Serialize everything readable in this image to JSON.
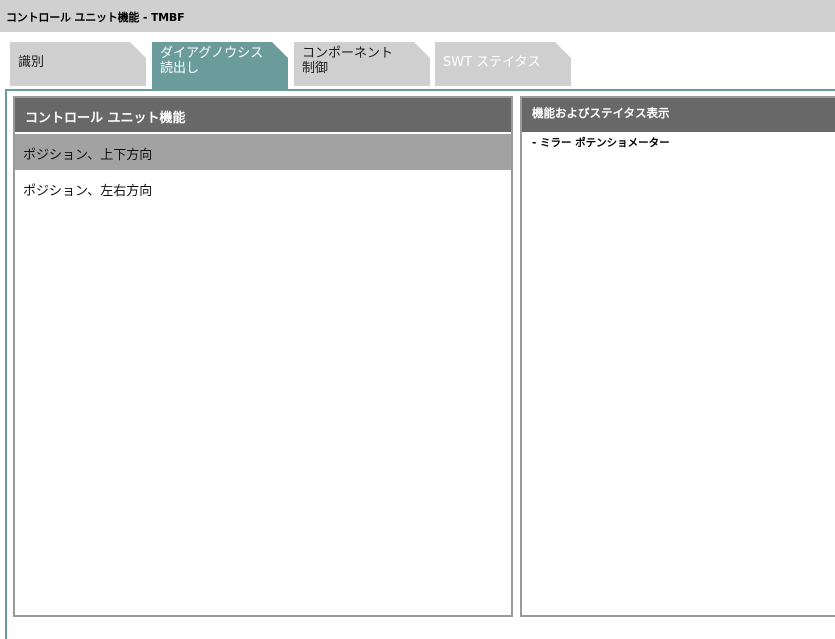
{
  "window": {
    "title": "コントロール ユニット機能 - TMBF"
  },
  "tabs": [
    {
      "label": "識別"
    },
    {
      "label": "ダイアグノウシス\n読出し"
    },
    {
      "label": "コンポーネント\n制御"
    },
    {
      "label": "SWT ステイタス"
    }
  ],
  "left_panel": {
    "header": "コントロール ユニット機能",
    "items": [
      {
        "label": "ポジション、上下方向"
      },
      {
        "label": "ポジション、左右方向"
      }
    ]
  },
  "right_panel": {
    "header": "機能およびステイタス表示",
    "lines": [
      "- ミラー ポテンショメーター"
    ]
  },
  "colors": {
    "accent": "#6a9c9c",
    "titlebar": "#d0d0d0",
    "panel_header": "#686868",
    "selected_row": "#a2a2a2",
    "tab_inactive": "#cfcfcf"
  }
}
